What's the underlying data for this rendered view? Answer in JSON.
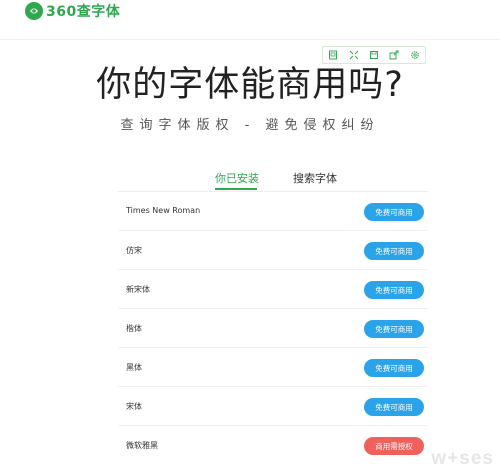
{
  "app": {
    "logo_text": "360查字体",
    "logo_color": "#2fa84f"
  },
  "toolbar": {
    "icons": [
      "screenshot-icon",
      "expand-icon",
      "save-icon",
      "share-icon",
      "settings-icon"
    ]
  },
  "hero": {
    "title": "你的字体能商用吗?",
    "subtitle": "查询字体版权 - 避免侵权纠纷"
  },
  "tabs": [
    {
      "label": "你已安装",
      "active": true
    },
    {
      "label": "搜索字体",
      "active": false
    }
  ],
  "fonts": [
    {
      "name": "Times New Roman",
      "status": "免费可商用",
      "status_type": "free"
    },
    {
      "name": "仿宋",
      "status": "免费可商用",
      "status_type": "free"
    },
    {
      "name": "新宋体",
      "status": "免费可商用",
      "status_type": "free"
    },
    {
      "name": "楷体",
      "status": "免费可商用",
      "status_type": "free"
    },
    {
      "name": "黑体",
      "status": "免费可商用",
      "status_type": "free"
    },
    {
      "name": "宋体",
      "status": "免费可商用",
      "status_type": "free"
    },
    {
      "name": "微软雅黑",
      "status": "商用需授权",
      "status_type": "paid"
    }
  ],
  "colors": {
    "accent": "#2fa84f",
    "free_badge": "#2aa3e8",
    "paid_badge": "#f0605c"
  },
  "watermark": {
    "text": "w+ses"
  }
}
